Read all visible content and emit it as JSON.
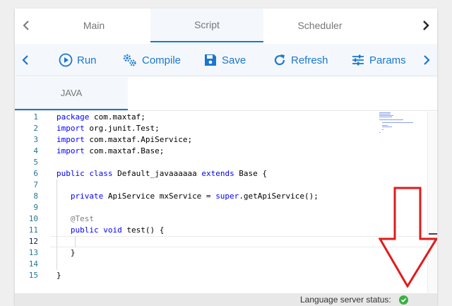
{
  "tabs": [
    {
      "label": "Main"
    },
    {
      "label": "Script"
    },
    {
      "label": "Scheduler"
    }
  ],
  "toolbar": {
    "run": "Run",
    "compile": "Compile",
    "save": "Save",
    "refresh": "Refresh",
    "params": "Params"
  },
  "language_tab": "JAVA",
  "editor": {
    "line_numbers": [
      "1",
      "2",
      "3",
      "4",
      "5",
      "6",
      "7",
      "8",
      "9",
      "10",
      "11",
      "12",
      "13",
      "14",
      "15"
    ],
    "current_line": 12
  },
  "status": {
    "label": "Language server status:",
    "state_color": "#3cb043"
  },
  "colors": {
    "accent": "#1976d2",
    "keyword": "#0000ff",
    "annotation": "#808080",
    "line_number": "#237893",
    "arrow": "#e01b1b"
  }
}
